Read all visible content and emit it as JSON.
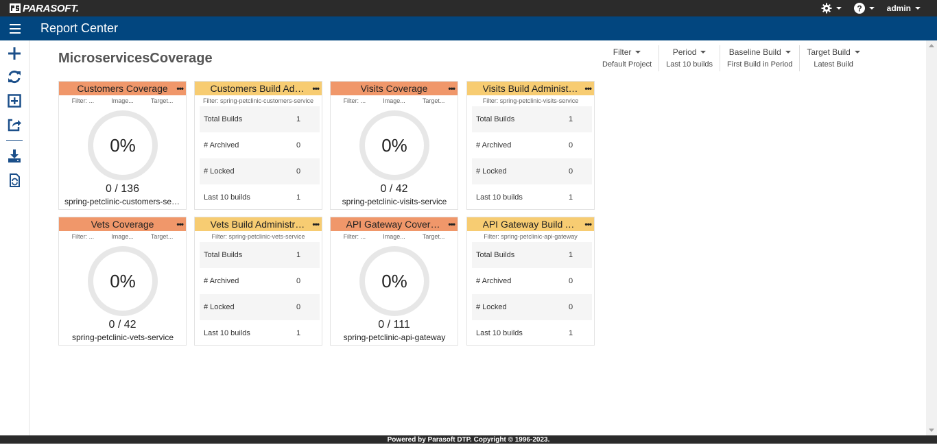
{
  "topbar": {
    "brand": "PARASOFT.",
    "user": "admin",
    "icons": [
      "gear-icon",
      "help-icon"
    ]
  },
  "navbar": {
    "title": "Report Center"
  },
  "sidebar": {
    "icons": [
      "plus-icon",
      "refresh-icon",
      "add-widget-icon",
      "share-icon",
      "download-icon",
      "import-icon"
    ]
  },
  "dashboard": {
    "title": "MicroservicesCoverage",
    "filters": [
      {
        "label": "Filter",
        "value": "Default Project"
      },
      {
        "label": "Period",
        "value": "Last 10 builds"
      },
      {
        "label": "Baseline Build",
        "value": "First Build in Period"
      },
      {
        "label": "Target Build",
        "value": "Latest Build"
      }
    ]
  },
  "coverage_widgets": [
    {
      "title": "Customers Coverage",
      "sub": [
        "Filter: ...",
        "Image...",
        "Target..."
      ],
      "percent": "0%",
      "count": "0 / 136",
      "name": "spring-petclinic-customers-service"
    },
    {
      "title": "Visits Coverage",
      "sub": [
        "Filter: ...",
        "Image...",
        "Target..."
      ],
      "percent": "0%",
      "count": "0 / 42",
      "name": "spring-petclinic-visits-service"
    },
    {
      "title": "Vets Coverage",
      "sub": [
        "Filter: ...",
        "Image...",
        "Target..."
      ],
      "percent": "0%",
      "count": "0 / 42",
      "name": "spring-petclinic-vets-service"
    },
    {
      "title": "API Gateway Coverage",
      "sub": [
        "Filter: ...",
        "Image...",
        "Target..."
      ],
      "percent": "0%",
      "count": "0 / 111",
      "name": "spring-petclinic-api-gateway"
    }
  ],
  "admin_widgets": [
    {
      "title": "Customers Build Administration",
      "filter": "Filter: spring-petclinic-customers-service",
      "rows": [
        [
          "Total Builds",
          "1"
        ],
        [
          "# Archived",
          "0"
        ],
        [
          "# Locked",
          "0"
        ],
        [
          "Last 10 builds",
          "1"
        ]
      ]
    },
    {
      "title": "Visits Build Administration",
      "filter": "Filter: spring-petclinic-visits-service",
      "rows": [
        [
          "Total Builds",
          "1"
        ],
        [
          "# Archived",
          "0"
        ],
        [
          "# Locked",
          "0"
        ],
        [
          "Last 10 builds",
          "1"
        ]
      ]
    },
    {
      "title": "Vets Build Administration",
      "filter": "Filter: spring-petclinic-vets-service",
      "rows": [
        [
          "Total Builds",
          "1"
        ],
        [
          "# Archived",
          "0"
        ],
        [
          "# Locked",
          "0"
        ],
        [
          "Last 10 builds",
          "1"
        ]
      ]
    },
    {
      "title": "API Gateway Build Administration",
      "filter": "Filter: spring-petclinic-api-gateway",
      "rows": [
        [
          "Total Builds",
          "1"
        ],
        [
          "# Archived",
          "0"
        ],
        [
          "# Locked",
          "0"
        ],
        [
          "Last 10 builds",
          "1"
        ]
      ]
    }
  ],
  "widget_menu_glyph": "•••",
  "footer": {
    "text": "Powered by Parasoft DTP. Copyright © 1996-2023."
  },
  "colors": {
    "topbar": "#2b2b2b",
    "navbar": "#02467f",
    "coverage_header": "#f0976a",
    "admin_header": "#f7cc72",
    "sidebar_icon": "#1b4f8a"
  }
}
